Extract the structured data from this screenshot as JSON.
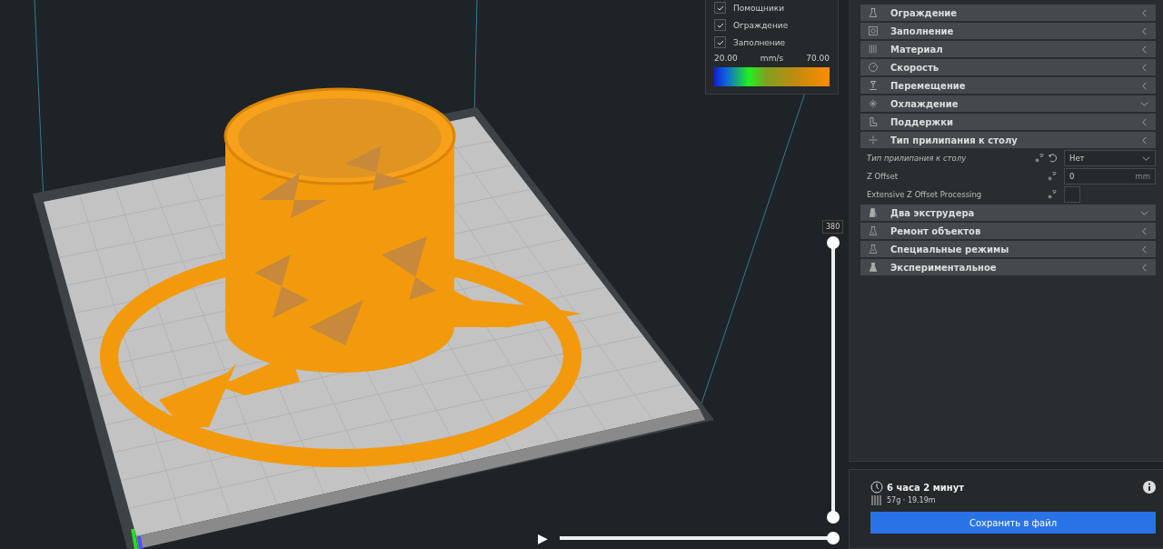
{
  "legend": {
    "checkboxes": [
      {
        "label": "Помощники",
        "checked": true
      },
      {
        "label": "Ограждение",
        "checked": true
      },
      {
        "label": "Заполнение",
        "checked": true
      }
    ],
    "min": "20.00",
    "unit": "mm/s",
    "max": "70.00"
  },
  "layer_slider": {
    "label": "380",
    "level": 1
  },
  "path_slider": {
    "play": "▶",
    "level": 1
  },
  "settings": [
    {
      "kind": "category",
      "title": "Ограждение",
      "expanded": false
    },
    {
      "kind": "category",
      "title": "Заполнение",
      "expanded": false
    },
    {
      "kind": "category",
      "title": "Материал",
      "expanded": false
    },
    {
      "kind": "category",
      "title": "Скорость",
      "expanded": false
    },
    {
      "kind": "category",
      "title": "Перемещение",
      "expanded": false
    },
    {
      "kind": "category",
      "title": "Охлаждение",
      "expanded": true
    },
    {
      "kind": "category",
      "title": "Поддержки",
      "expanded": false
    },
    {
      "kind": "category",
      "title": "Тип прилипания к столу",
      "expanded": false
    },
    {
      "kind": "dropdown",
      "label": "Тип прилипания к столу",
      "modified": true,
      "value": "Нет"
    },
    {
      "kind": "number",
      "label": "Z Offset",
      "modified": false,
      "value": "0",
      "unit": "mm"
    },
    {
      "kind": "checkbox",
      "label": "Extensive Z Offset Processing",
      "modified": false,
      "checked": false
    },
    {
      "kind": "category",
      "title": "Два экструдера",
      "expanded": true
    },
    {
      "kind": "category",
      "title": "Ремонт объектов",
      "expanded": false
    },
    {
      "kind": "category",
      "title": "Специальные режимы",
      "expanded": false
    },
    {
      "kind": "category",
      "title": "Экспериментальное",
      "expanded": false
    }
  ],
  "summary": {
    "time": "6 часа 2 минут",
    "material": "57g · 19.19m",
    "button": "Сохранить в файл"
  }
}
